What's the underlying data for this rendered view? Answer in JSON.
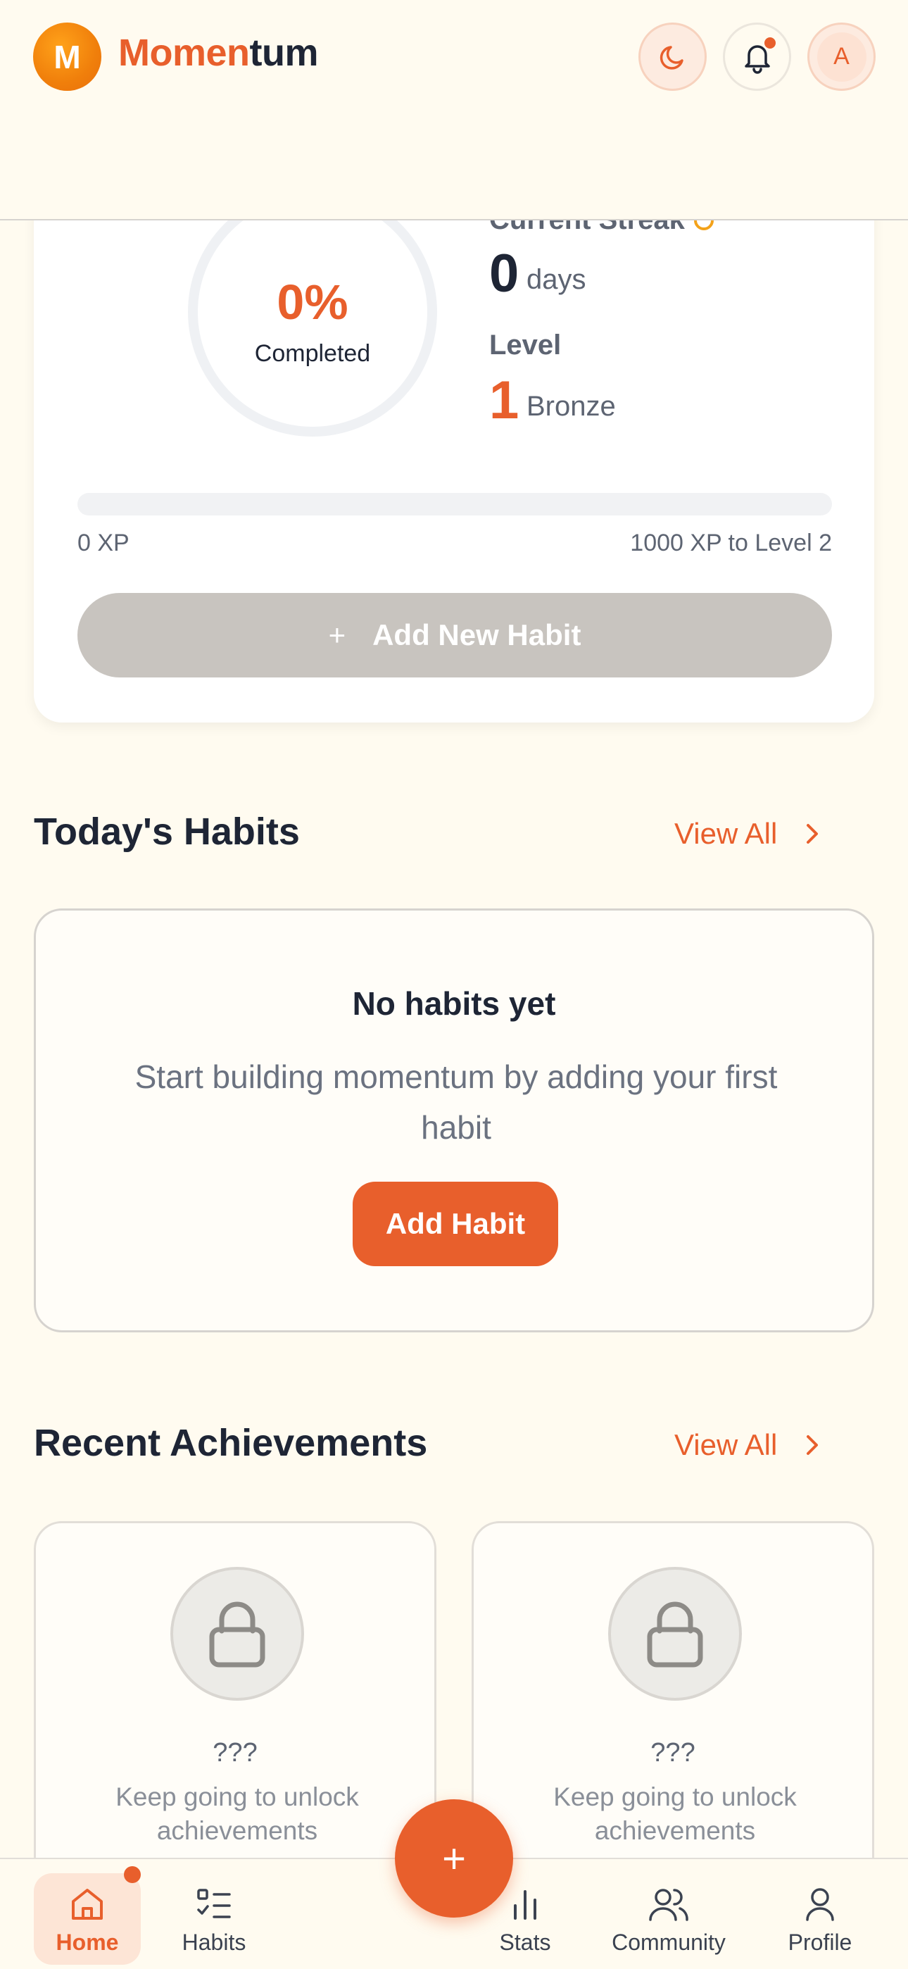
{
  "header": {
    "logo_letter": "M",
    "brand_part1": "Momen",
    "brand_part2": "tum",
    "avatar_initial": "A",
    "icons": [
      "moon-icon",
      "bell-icon"
    ]
  },
  "stats": {
    "completion_percent_text": "0%",
    "completion_label": "Completed",
    "completion_fraction": 0,
    "streak_label": "Current Streak",
    "streak_value": "0",
    "streak_unit": "days",
    "level_label": "Level",
    "level_value": "1",
    "level_name": "Bronze",
    "xp_current": "0 XP",
    "xp_target": "1000 XP to Level 2",
    "xp_fraction": 0,
    "add_habit_label": "Add New Habit"
  },
  "todays_habits": {
    "title": "Today's Habits",
    "view_all": "View All",
    "empty_title": "No habits yet",
    "empty_desc": "Start building momentum by adding your first habit",
    "add_button": "Add Habit"
  },
  "achievements": {
    "title": "Recent Achievements",
    "view_all": "View All",
    "items": [
      {
        "name": "???",
        "desc": "Keep going to unlock achievements"
      },
      {
        "name": "???",
        "desc": "Keep going to unlock achievements"
      }
    ]
  },
  "nav": {
    "items": [
      {
        "label": "Home",
        "icon": "home-icon"
      },
      {
        "label": "Habits",
        "icon": "list-check-icon"
      },
      {
        "label": "Stats",
        "icon": "bar-chart-icon"
      },
      {
        "label": "Community",
        "icon": "users-icon"
      },
      {
        "label": "Profile",
        "icon": "user-icon"
      }
    ],
    "fab": "+"
  },
  "colors": {
    "accent": "#e85f2c",
    "background": "#fffbf0",
    "text": "#1e2535",
    "muted": "#5d6472"
  }
}
